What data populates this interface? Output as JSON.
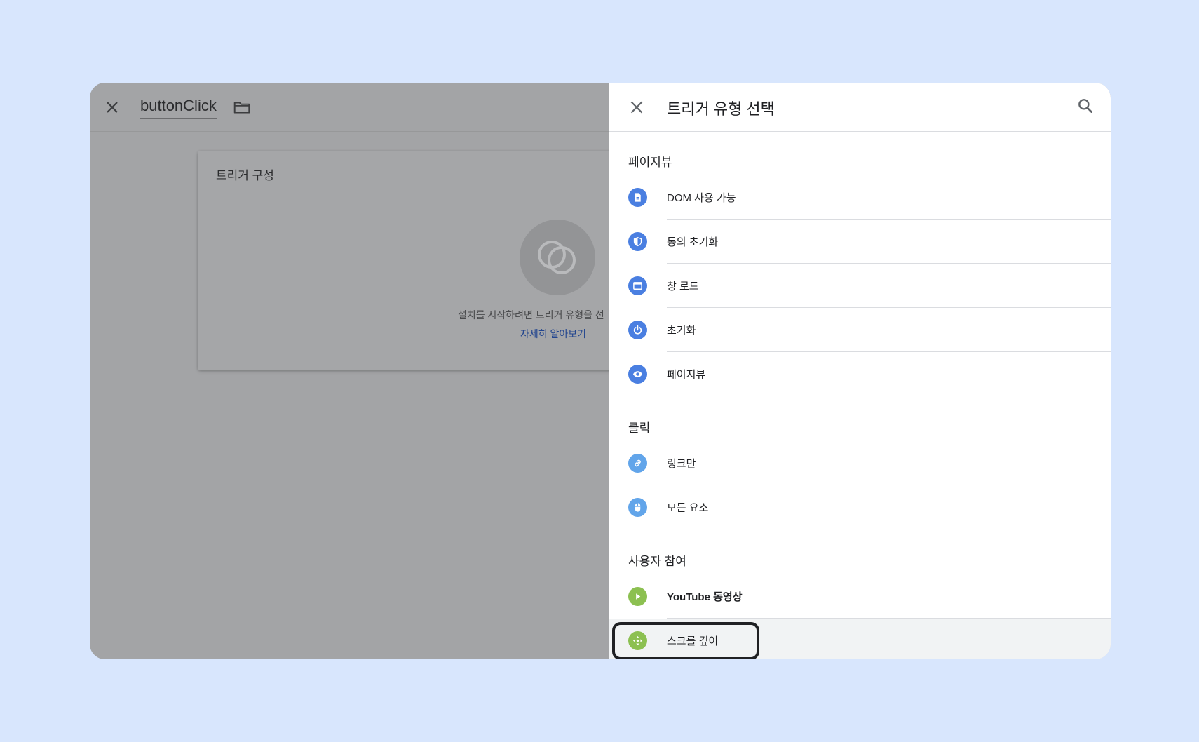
{
  "editor": {
    "name": "buttonClick",
    "card_title": "트리거 구성",
    "hint": "설치를 시작하려면 트리거 유형을 선",
    "learn_more": "자세히 알아보기"
  },
  "panel": {
    "title": "트리거 유형 선택",
    "sections": [
      {
        "title": "페이지뷰",
        "items": [
          {
            "label": "DOM 사용 가능",
            "icon": "document-icon",
            "color": "#4a7fe1"
          },
          {
            "label": "동의 초기화",
            "icon": "shield-icon",
            "color": "#4a7fe1"
          },
          {
            "label": "창 로드",
            "icon": "window-icon",
            "color": "#4a7fe1"
          },
          {
            "label": "초기화",
            "icon": "power-icon",
            "color": "#4a7fe1"
          },
          {
            "label": "페이지뷰",
            "icon": "eye-icon",
            "color": "#4a7fe1"
          }
        ]
      },
      {
        "title": "클릭",
        "items": [
          {
            "label": "링크만",
            "icon": "link-icon",
            "color": "#62a5ea"
          },
          {
            "label": "모든 요소",
            "icon": "mouse-icon",
            "color": "#62a5ea"
          }
        ]
      },
      {
        "title": "사용자 참여",
        "items": [
          {
            "label": "YouTube 동영상",
            "icon": "play-icon",
            "color": "#8cc051"
          },
          {
            "label": "스크롤 깊이",
            "icon": "scroll-icon",
            "color": "#8cc051",
            "selected": true
          }
        ]
      }
    ]
  }
}
